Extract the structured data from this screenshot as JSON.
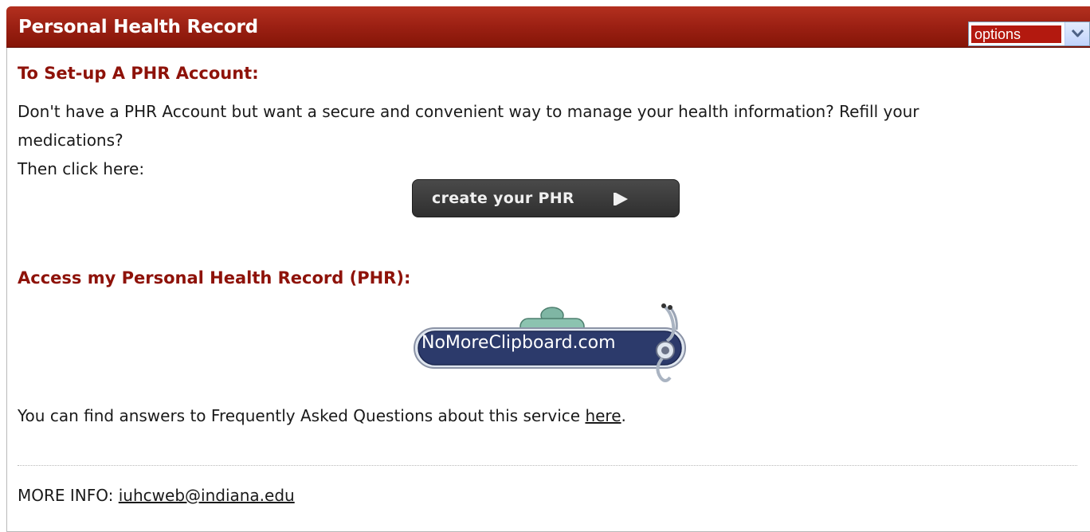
{
  "panel": {
    "title": "Personal Health Record",
    "options_select": {
      "value": "options"
    }
  },
  "setup": {
    "heading": "To Set-up A PHR Account:",
    "line1": "Don't have a PHR Account but want a secure and convenient way to manage your health information? Refill your",
    "line2": "medications?",
    "line3": "Then click here:",
    "button_label": "create your PHR"
  },
  "access": {
    "heading": "Access my Personal Health Record (PHR):",
    "logo_text": "NoMoreClipboard.com"
  },
  "faq": {
    "text_before": "You can find answers to Frequently Asked Questions about this service ",
    "link_text": "here",
    "text_after": "."
  },
  "more_info": {
    "label": "MORE INFO: ",
    "email": "iuhcweb@indiana.edu"
  },
  "colors": {
    "header_bg": "#9b2013",
    "heading_text": "#8e1209",
    "button_bg": "#3a3a3a",
    "logo_bg": "#2c3a6b"
  },
  "icons": {
    "select_arrow": "chevron-down-icon",
    "button_arrow": "play-arrow-icon",
    "logo_clip": "clipboard-icon",
    "logo_stethoscope": "stethoscope-icon"
  }
}
